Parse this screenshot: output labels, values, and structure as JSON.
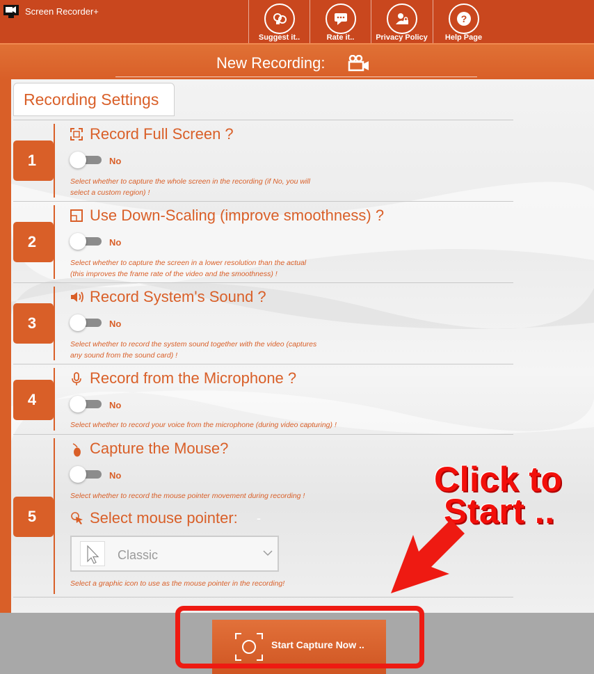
{
  "app": {
    "title": "Screen Recorder+"
  },
  "toolbar": {
    "items": [
      {
        "label": "Suggest it..",
        "icon": "lightbulb-icon"
      },
      {
        "label": "Rate it..",
        "icon": "speech-bubble-icon"
      },
      {
        "label": "Privacy Policy",
        "icon": "user-lock-icon"
      },
      {
        "label": "Help Page",
        "icon": "question-icon"
      }
    ]
  },
  "banner": {
    "title": "New Recording:",
    "icon": "video-camera-icon"
  },
  "settings": {
    "tab_label": "Recording Settings",
    "sections": [
      {
        "number": "1",
        "title": "Record Full Screen ?",
        "icon": "fullscreen-icon",
        "toggle_value": "No",
        "description_line1": "Select whether to capture the whole screen in the recording (if No, you will",
        "description_line2": "select a custom region) !"
      },
      {
        "number": "2",
        "title": "Use Down-Scaling (improve smoothness) ?",
        "icon": "scale-icon",
        "toggle_value": "No",
        "description_line1": "Select whether to capture the screen in a lower resolution than the actual",
        "description_line2": "(this improves the frame rate of the video and the smoothness) !"
      },
      {
        "number": "3",
        "title": "Record System's Sound ?",
        "icon": "speaker-icon",
        "toggle_value": "No",
        "description_line1": "Select whether to record the system sound together with the video (captures",
        "description_line2": "any sound from the sound card) !"
      },
      {
        "number": "4",
        "title": "Record from the Microphone ?",
        "icon": "microphone-icon",
        "toggle_value": "No",
        "description_line1": "Select whether to record your voice from the microphone (during video capturing) !"
      },
      {
        "number": "5",
        "title": "Capture the Mouse?",
        "icon": "mouse-icon",
        "toggle_value": "No",
        "description_line1": "Select whether to record the mouse pointer movement during recording !",
        "pointer_title": "Select mouse pointer:",
        "pointer_suffix": "-",
        "pointer_select_value": "Classic",
        "pointer_description": "Select a graphic icon to use as the mouse pointer in the recording!"
      }
    ]
  },
  "start_button": {
    "label": "Start Capture Now .."
  },
  "callout": {
    "line1": "Click to",
    "line2": "Start .."
  },
  "colors": {
    "accent": "#d95f28",
    "topbar": "#c9471e",
    "callout_red": "#ee1a12"
  }
}
